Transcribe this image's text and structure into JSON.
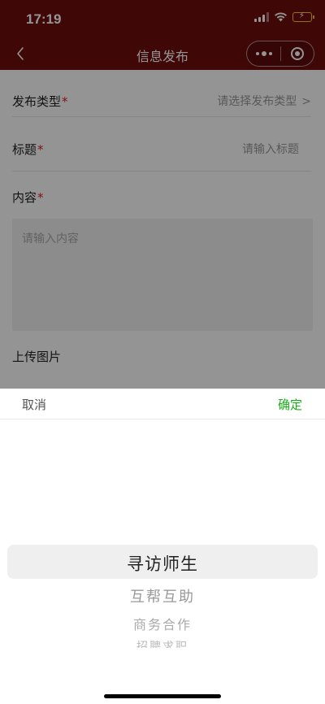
{
  "status_bar": {
    "time": "17:19"
  },
  "nav": {
    "title": "信息发布"
  },
  "form": {
    "type_row": {
      "label": "发布类型",
      "required": "*",
      "placeholder": "请选择发布类型",
      "chevron": ">"
    },
    "title_row": {
      "label": "标题",
      "required": "*",
      "placeholder": "请输入标题"
    },
    "content": {
      "label": "内容",
      "required": "*",
      "placeholder": "请输入内容"
    },
    "upload": {
      "label": "上传图片"
    }
  },
  "picker": {
    "cancel_label": "取消",
    "confirm_label": "确定",
    "options": [
      "寻访师生",
      "互帮互助",
      "商务合作",
      "招聘求职"
    ],
    "selected_index": 0
  },
  "colors": {
    "header_bg": "#6e0d0d",
    "confirm": "#1aad19",
    "required": "#e02020"
  }
}
